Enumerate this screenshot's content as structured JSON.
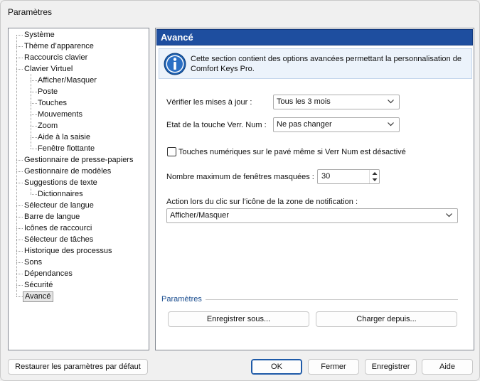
{
  "window": {
    "title": "Paramètres"
  },
  "tree": {
    "items": [
      {
        "label": "Système",
        "level": 0
      },
      {
        "label": "Thème d’apparence",
        "level": 0
      },
      {
        "label": "Raccourcis clavier",
        "level": 0
      },
      {
        "label": "Clavier Virtuel",
        "level": 0
      },
      {
        "label": "Afficher/Masquer",
        "level": 1
      },
      {
        "label": "Poste",
        "level": 1
      },
      {
        "label": "Touches",
        "level": 1
      },
      {
        "label": "Mouvements",
        "level": 1
      },
      {
        "label": "Zoom",
        "level": 1
      },
      {
        "label": "Aide à la saisie",
        "level": 1
      },
      {
        "label": "Fenêtre flottante",
        "level": 1
      },
      {
        "label": "Gestionnaire de presse-papiers",
        "level": 0
      },
      {
        "label": "Gestionnaire de modèles",
        "level": 0
      },
      {
        "label": "Suggestions de texte",
        "level": 0
      },
      {
        "label": "Dictionnaires",
        "level": 1
      },
      {
        "label": "Sélecteur de langue",
        "level": 0
      },
      {
        "label": "Barre de langue",
        "level": 0
      },
      {
        "label": "Icônes de raccourci",
        "level": 0
      },
      {
        "label": "Sélecteur de tâches",
        "level": 0
      },
      {
        "label": "Historique des processus",
        "level": 0
      },
      {
        "label": "Sons",
        "level": 0
      },
      {
        "label": "Dépendances",
        "level": 0
      },
      {
        "label": "Sécurité",
        "level": 0
      },
      {
        "label": "Avancé",
        "level": 0,
        "selected": true
      }
    ]
  },
  "panel": {
    "title": "Avancé",
    "info": "Cette section contient des options avancées permettant la personnalisation de Comfort Keys Pro.",
    "check_updates": {
      "label": "Vérifier les mises à jour :",
      "value": "Tous les 3 mois"
    },
    "numlock": {
      "label": "Etat de la touche Verr. Num :",
      "value": "Ne pas changer"
    },
    "numpad_checkbox": {
      "label": "Touches numériques sur le pavé même si Verr Num est désactivé",
      "checked": false
    },
    "max_windows": {
      "label": "Nombre maximum de fenêtres masquées :",
      "value": "30"
    },
    "tray_action": {
      "label": "Action lors du clic sur l’icône de la zone de notification :",
      "value": "Afficher/Masquer"
    },
    "settings_group": {
      "label": "Paramètres",
      "save_as": "Enregistrer sous...",
      "load_from": "Charger depuis..."
    }
  },
  "footer": {
    "restore": "Restaurer les paramètres par défaut",
    "ok": "OK",
    "close": "Fermer",
    "save": "Enregistrer",
    "help": "Aide"
  },
  "colors": {
    "header_bg": "#1e4e9f",
    "accent": "#1e5aa8",
    "info_bg": "#ecf3fb"
  }
}
